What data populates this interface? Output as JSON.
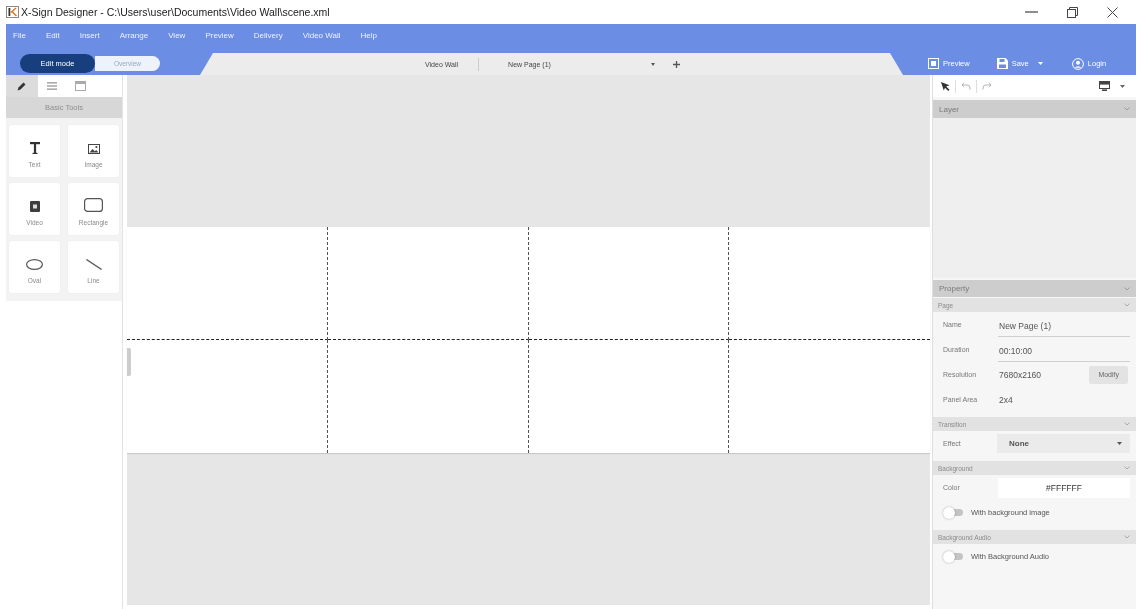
{
  "window": {
    "title": "X-Sign Designer - C:\\Users\\user\\Documents\\Video Wall\\scene.xml"
  },
  "menu_bar": [
    "File",
    "Edit",
    "Insert",
    "Arrange",
    "View",
    "Preview",
    "Delivery",
    "Video Wall",
    "Help"
  ],
  "mode_switch": [
    {
      "label": "Edit mode",
      "selected": true
    },
    {
      "label": "Overview",
      "selected": false
    }
  ],
  "page_tabs": {
    "group": "Video Wall",
    "tabs": [
      "New Page (1)"
    ]
  },
  "actions": [
    {
      "kind": "preview",
      "label": "Preview"
    },
    {
      "kind": "save",
      "label": "Save"
    },
    {
      "kind": "login",
      "label": "Login"
    }
  ],
  "left_panel": {
    "tabs": [
      {
        "selected": true
      },
      {
        "selected": false
      },
      {
        "selected": false
      }
    ],
    "title": "Basic Tools",
    "tools": [
      "Text",
      "Image",
      "Video",
      "Rectangle",
      "Oval",
      "Line"
    ]
  },
  "toolbar": {
    "undo": {
      "disabled": true
    },
    "redo": {
      "disabled": true
    }
  },
  "layer_panel": {
    "title": "Layer",
    "expanded": true
  },
  "property_panel": {
    "title": "Property",
    "expanded": true,
    "sections": [
      {
        "title": "Page",
        "expanded": true,
        "fields": [
          {
            "kind": "text",
            "label": "Name",
            "value": "New Page (1)"
          },
          {
            "kind": "text",
            "label": "Duration",
            "value": "00:10:00"
          },
          {
            "kind": "button",
            "label": "Resolution",
            "value": "7680x2160",
            "button": "Modify"
          },
          {
            "kind": "plain",
            "label": "Panel Area",
            "value": "2x4"
          }
        ]
      },
      {
        "title": "Transition",
        "expanded": true,
        "fields": [
          {
            "kind": "select",
            "label": "Effect",
            "value": "None"
          }
        ]
      },
      {
        "title": "Background",
        "expanded": true,
        "fields": [
          {
            "kind": "color",
            "label": "Color",
            "value": "#FFFFFF"
          },
          {
            "kind": "toggle",
            "label": "With background image",
            "on": false
          }
        ]
      },
      {
        "title": "Background Audio",
        "expanded": true,
        "fields": [
          {
            "kind": "toggle",
            "label": "With Background Audio",
            "on": false
          }
        ]
      }
    ]
  }
}
